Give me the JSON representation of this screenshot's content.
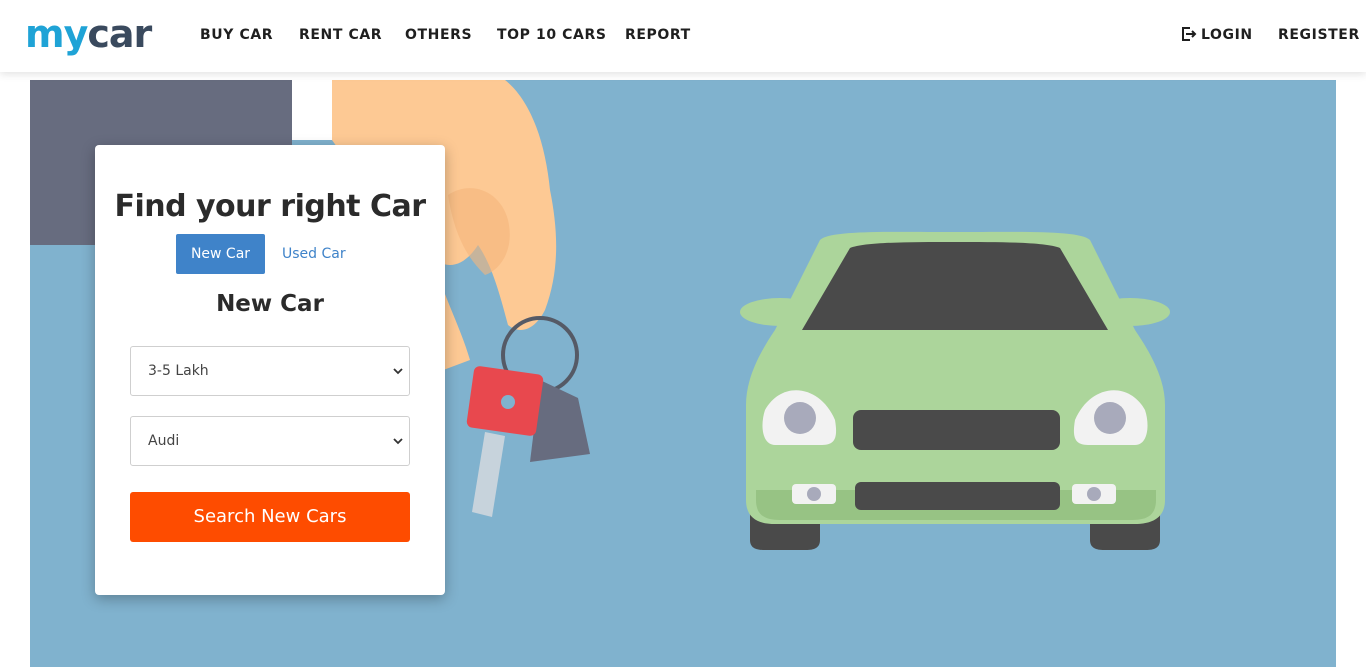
{
  "logo": {
    "part1": "my",
    "part2": "car"
  },
  "nav": {
    "buy_car": "BUY CAR",
    "rent_car": "RENT CAR",
    "others": "OTHERS",
    "top10": "TOP 10 CARS",
    "report": "REPORT",
    "login": "LOGIN",
    "register": "REGISTER"
  },
  "search_card": {
    "title": "Find your right Car",
    "tabs": {
      "new": "New Car",
      "used": "Used Car"
    },
    "active_tab": "New Car",
    "section_title": "New Car",
    "budget_selected": "3-5 Lakh",
    "brand_selected": "Audi",
    "search_button": "Search New Cars"
  },
  "icons": {
    "login": "sign-in-icon",
    "dropdown": "chevron-down-icon"
  },
  "colors": {
    "brand_blue": "#1fa3d6",
    "tab_active": "#3f83c9",
    "search_button": "#fe4c00",
    "hero_background": "#80b2ce",
    "car_body": "#acd59b"
  }
}
